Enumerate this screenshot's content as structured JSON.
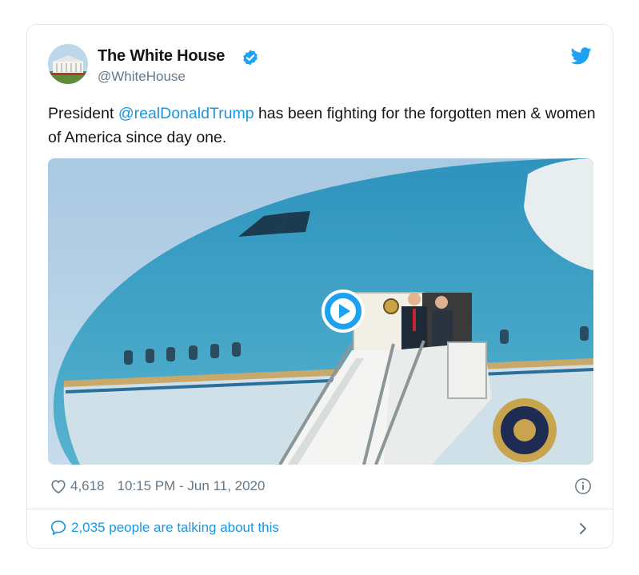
{
  "tweet": {
    "author_name": "The White House",
    "author_handle": "@WhiteHouse",
    "text_before": "President ",
    "mention": "@realDonaldTrump",
    "text_after": " has been fighting for the forgotten men & women of America since day one.",
    "like_count": "4,618",
    "timestamp": "10:15 PM - Jun 11, 2020",
    "talking_text": "2,035 people are talking about this"
  },
  "icons": {
    "verified": "verified-badge-icon",
    "brand": "twitter-bird-icon",
    "play": "play-icon",
    "like": "heart-icon",
    "info": "info-icon",
    "reply": "speech-bubble-icon",
    "chevron": "chevron-right-icon"
  },
  "colors": {
    "link": "#1b95e0",
    "secondary_text": "#657786",
    "border": "#e1e8ed",
    "primary_text": "#14171a"
  }
}
